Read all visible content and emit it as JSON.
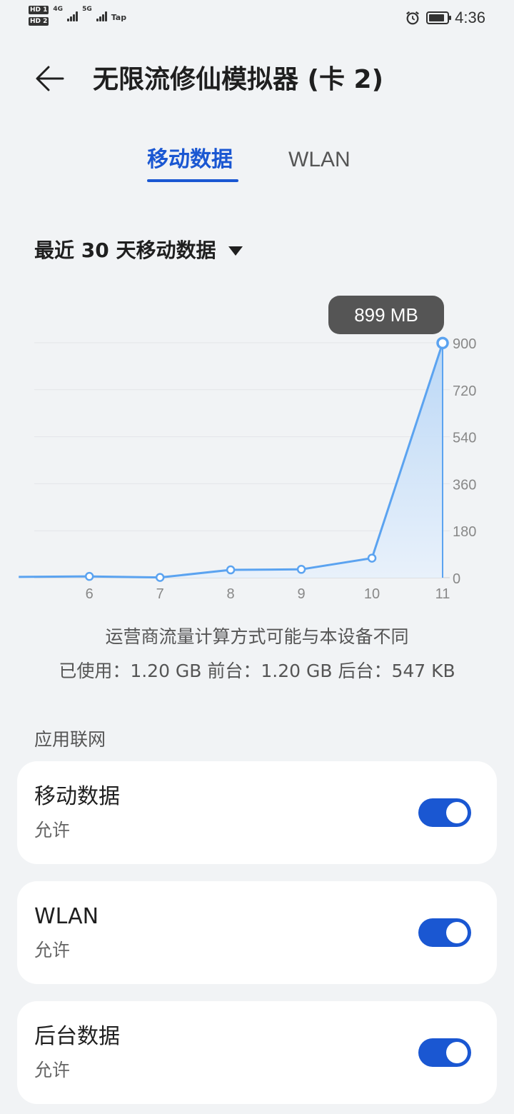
{
  "status_bar": {
    "sim1_label": "HD 1",
    "sim2_label": "HD 2",
    "net1": "4G",
    "net2": "5G",
    "carrier_tag": "Tap",
    "time": "4:36",
    "battery_level": 0.85,
    "icons": [
      "alarm-icon",
      "battery-icon",
      "signal-icon"
    ]
  },
  "header": {
    "title": "无限流修仙模拟器 (卡 2)",
    "back_icon": "arrow-left-icon"
  },
  "tabs": [
    {
      "label": "移动数据",
      "active": true
    },
    {
      "label": "WLAN",
      "active": false
    }
  ],
  "period": {
    "label": "最近 30 天移动数据",
    "dropdown_icon": "caret-down-icon"
  },
  "chart_data": {
    "type": "area",
    "x": [
      5,
      6,
      7,
      8,
      9,
      10,
      11
    ],
    "x_ticks": [
      "6",
      "7",
      "8",
      "9",
      "10",
      "11"
    ],
    "y_ticks": [
      "0",
      "180",
      "360",
      "540",
      "720",
      "900"
    ],
    "values": [
      3,
      5,
      1,
      30,
      32,
      75,
      899
    ],
    "ylim": [
      0,
      900
    ],
    "xlim": [
      5.22,
      11.0
    ],
    "highlight": {
      "x": 11,
      "label": "899 MB"
    },
    "grid": true,
    "line_color": "#5ba3f0",
    "fill_color": "#cfe3f8"
  },
  "notes": {
    "carrier_note": "运营商流量计算方式可能与本设备不同",
    "usage": "已使用：1.20 GB 前台：1.20 GB 后台：547 KB"
  },
  "section": {
    "label": "应用联网"
  },
  "settings": [
    {
      "title": "移动数据",
      "subtitle": "允许",
      "enabled": true
    },
    {
      "title": "WLAN",
      "subtitle": "允许",
      "enabled": true
    },
    {
      "title": "后台数据",
      "subtitle": "允许",
      "enabled": true
    }
  ],
  "colors": {
    "accent": "#1a57d2",
    "background": "#f1f3f5",
    "card": "#ffffff",
    "tooltip": "#555555"
  }
}
